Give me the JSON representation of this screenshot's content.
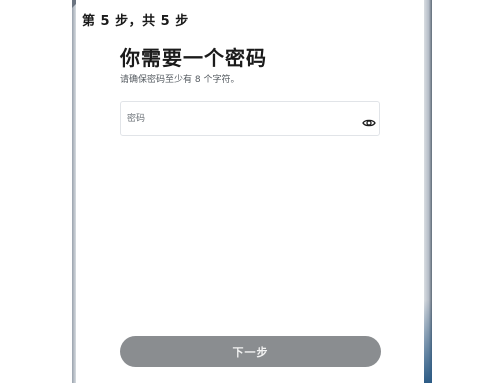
{
  "header": {
    "step_label": "第 5 步，共 5 步"
  },
  "main": {
    "title": "你需要一个密码",
    "subtitle": "请确保密码至少有 8 个字符。"
  },
  "password_field": {
    "label": "密码",
    "value": "",
    "reveal_icon": "eye-icon"
  },
  "footer": {
    "next_label": "下一步"
  },
  "colors": {
    "button_disabled": "#8a8d90",
    "text_primary": "#1b1b1b",
    "border": "#e1e4e8"
  }
}
